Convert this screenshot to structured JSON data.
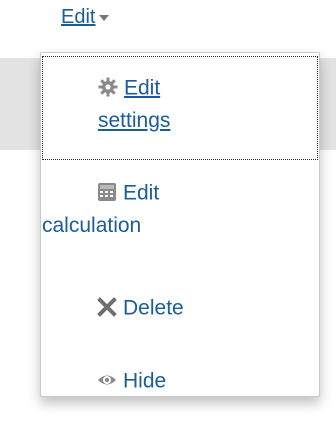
{
  "toggle": {
    "label": "Edit",
    "caret_icon": "caret-down-icon"
  },
  "menu": {
    "items": [
      {
        "line1": "Edit",
        "line2": "settings",
        "icon": "gear-icon"
      },
      {
        "line1": "Edit",
        "line2": "calculation",
        "icon": "calculator-icon"
      },
      {
        "line1": "Delete",
        "icon": "close-x-icon"
      },
      {
        "line1": "Hide",
        "icon": "eye-icon"
      }
    ]
  },
  "colors": {
    "link": "#1a5d99",
    "icon": "#888888",
    "background_band": "#e3e3e3"
  }
}
